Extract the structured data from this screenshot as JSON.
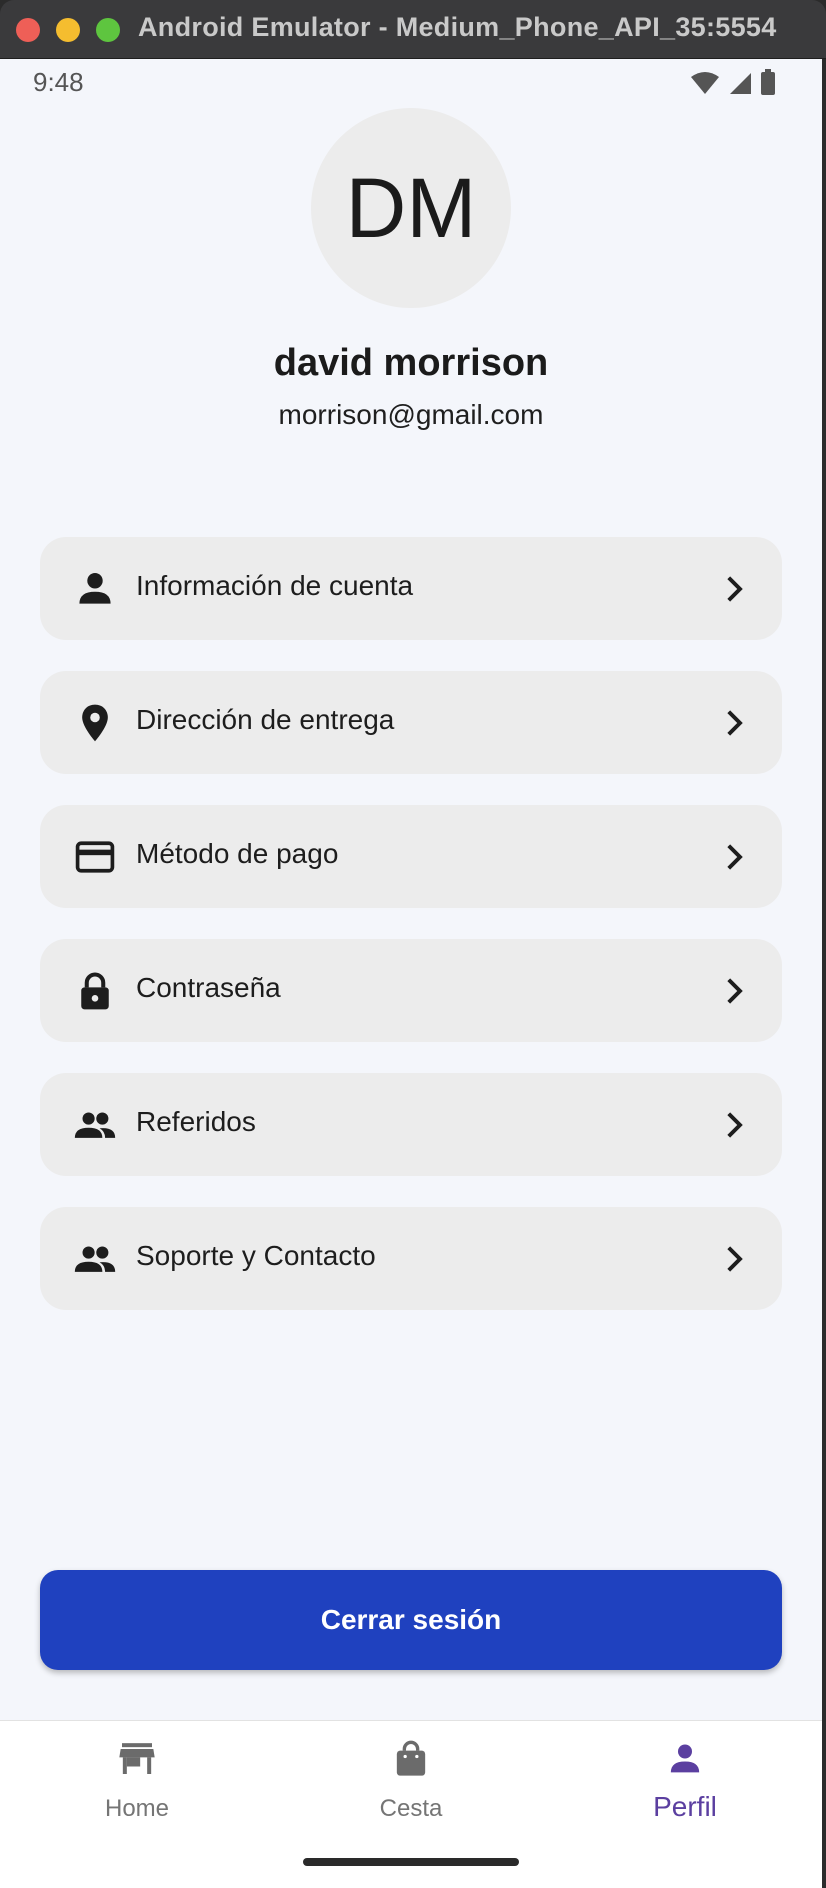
{
  "window": {
    "title": "Android Emulator - Medium_Phone_API_35:5554"
  },
  "status_bar": {
    "time": "9:48"
  },
  "profile": {
    "initials": "DM",
    "name": "david morrison",
    "email": "morrison@gmail.com"
  },
  "menu": [
    {
      "label": "Información de cuenta",
      "icon": "person-icon"
    },
    {
      "label": "Dirección de entrega",
      "icon": "location-pin-icon"
    },
    {
      "label": "Método de pago",
      "icon": "credit-card-icon"
    },
    {
      "label": "Contraseña",
      "icon": "lock-icon"
    },
    {
      "label": "Referidos",
      "icon": "group-icon"
    },
    {
      "label": "Soporte y Contacto",
      "icon": "group-icon"
    }
  ],
  "logout_label": "Cerrar sesión",
  "bottom_nav": [
    {
      "label": "Home",
      "icon": "store-icon"
    },
    {
      "label": "Cesta",
      "icon": "shopping-bag-icon"
    },
    {
      "label": "Perfil",
      "icon": "person-icon",
      "active": true
    }
  ],
  "colors": {
    "primary_button": "#1f41bf",
    "active_nav": "#5b3fa0",
    "screen_background": "#f4f6fb",
    "menu_item_background": "#ececec"
  }
}
